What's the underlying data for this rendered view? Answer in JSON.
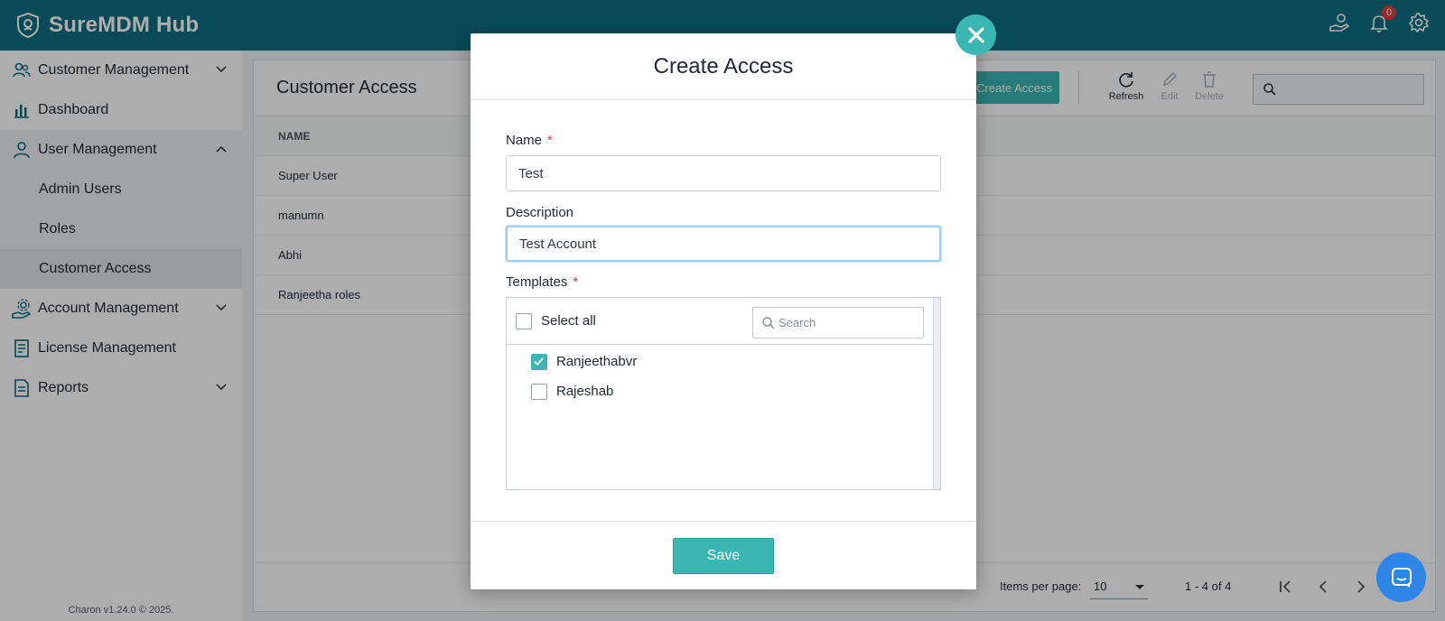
{
  "app": {
    "title": "SureMDM Hub",
    "notification_count": "0"
  },
  "sidebar": {
    "items": [
      {
        "label": "Customer Management"
      },
      {
        "label": "Dashboard"
      },
      {
        "label": "User Management"
      },
      {
        "label": "Admin Users"
      },
      {
        "label": "Roles"
      },
      {
        "label": "Customer Access"
      },
      {
        "label": "Account Management"
      },
      {
        "label": "License Management"
      },
      {
        "label": "Reports"
      }
    ],
    "footer": "Charon v1.24.0 © 2025."
  },
  "main": {
    "title": "Customer Access",
    "create_label": "Create Access",
    "toolbar": {
      "refresh": "Refresh",
      "edit": "Edit",
      "delete": "Delete"
    },
    "table": {
      "column": "NAME",
      "rows": [
        "Super User",
        "manumn",
        "Abhi",
        "Ranjeetha roles"
      ]
    },
    "pager": {
      "items_per_page_label": "Items per page:",
      "items_per_page": "10",
      "range": "1 - 4 of 4"
    }
  },
  "modal": {
    "title": "Create Access",
    "name_label": "Name",
    "name_value": "Test",
    "description_label": "Description",
    "description_value": "Test Account",
    "templates_label": "Templates",
    "required_mark": "*",
    "select_all": "Select all",
    "search_placeholder": "Search",
    "templates": [
      {
        "label": "Ranjeethabvr",
        "checked": true
      },
      {
        "label": "Rajeshab",
        "checked": false
      }
    ],
    "save_label": "Save"
  },
  "colors": {
    "brand": "#0b6e82",
    "accent": "#3ab7b3",
    "required": "#e23b3b",
    "chat": "#2f86e6"
  }
}
